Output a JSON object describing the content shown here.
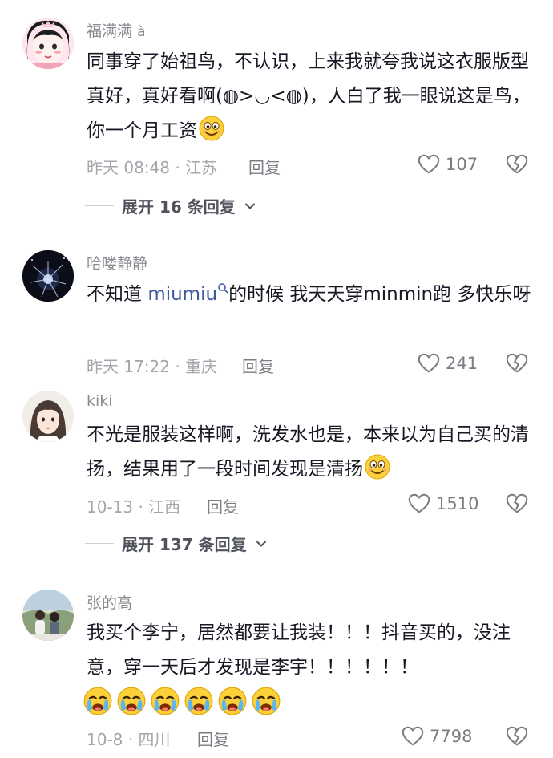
{
  "comments": [
    {
      "username": "福满满",
      "username_suffix": "à",
      "text": "同事穿了始祖鸟，不认识，上来我就夸我说这衣服版型真好，真好看啊(◍>◡<◍)，人白了我一眼说这是鸟，你一个月工资",
      "time_location": "昨天 08:48 · 江苏",
      "reply_label": "回复",
      "likes": "107",
      "expand_label": "展开 16 条回复"
    },
    {
      "username": "哈喽静静",
      "text_before_link": "不知道 ",
      "link_text": "miumiu",
      "text_after_link": "的时候 我天天穿minmin跑 多快乐呀",
      "time_location": "昨天 17:22 · 重庆",
      "reply_label": "回复",
      "likes": "241"
    },
    {
      "username": "kiki",
      "text": "不光是服装这样啊，洗发水也是，本来以为自己买的清扬，结果用了一段时间发现是清扬",
      "time_location": "10-13 · 江西",
      "reply_label": "回复",
      "likes": "1510",
      "expand_label": "展开 137 条回复"
    },
    {
      "username": "张的高",
      "text": "我买个李宁，居然都要让我装！！！抖音买的，没注意，穿一天后才发现是李宇！！！！！！",
      "time_location": "10-8 · 四川",
      "reply_label": "回复",
      "likes": "7798"
    }
  ],
  "icons": {
    "like": "heart-outline-icon",
    "dislike": "broken-heart-icon",
    "expand": "chevron-down-icon",
    "search": "search-icon",
    "emoji_smile": "smiling-face-emoji",
    "emoji_cry": "crying-face-emoji"
  },
  "colors": {
    "link": "#3d5a9e",
    "meta": "#a4a6ab",
    "username": "#8a8b91"
  }
}
